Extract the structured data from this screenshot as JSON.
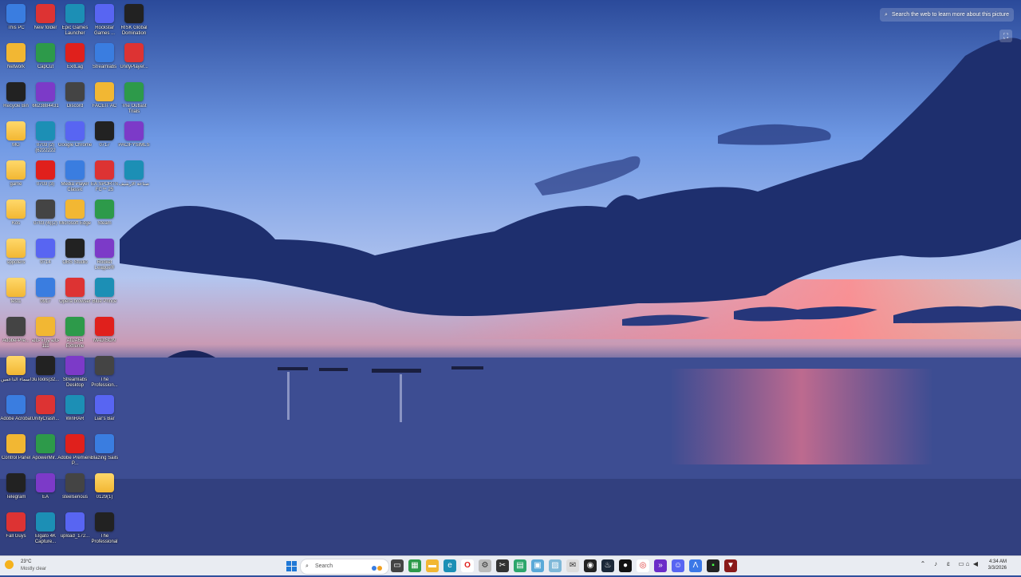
{
  "desktop": {
    "lens": {
      "label": "Search the web to learn more about this picture",
      "icon": "visual-search-icon",
      "corner_icon": "lens-corner-icon"
    },
    "icons": [
      [
        "This PC",
        "Network",
        "Recycle Bin",
        "MG",
        "game",
        "Kos",
        "sppoters",
        "test1",
        "Adobe-Pre...",
        "اسماء الداعمين",
        "Adobe Acrobat",
        "Control Panel",
        "Telegram",
        "Fall Guys"
      ],
      [
        "New folder",
        "CapCut",
        "6623884431",
        "0703 (2)(6222222",
        "0703 (3)",
        "0703 (4)(2)",
        "0714",
        "0917",
        "حالة وراء حالة 111",
        "3uTools(32...",
        "UnityCrash...",
        "ApowerMir...",
        "EA",
        "Elgato 4K Capture..."
      ],
      [
        "Epic Games Launcher",
        "ExitLag",
        "Discord",
        "Google Chrome",
        "Media Player Classic",
        "Microsoft Edge",
        "OBS Studio",
        "Opera browser",
        "AIDA64 Extreme",
        "Streamlabs Desktop",
        "WinRAR",
        "Adobe Premiere P...",
        "steelserious",
        "upload_172..."
      ],
      [
        "Rockstar Games ...",
        "Streamlabs",
        "FACEIT AC",
        "0717",
        "EA SPORTS FC™ 25",
        "Steam",
        "Rocket League®",
        "Blue Prince",
        "MADISON",
        "The Profession...",
        "Liar's Bar",
        "Blazing Sails",
        "0129(1)",
        "The Professional"
      ],
      [
        "RISK Global Domination",
        "UnityPlayer...",
        "The Outlast Trials",
        "PACIFYSIMLS",
        "صناعة الأرشيف",
        "",
        "",
        "",
        "",
        "",
        "",
        "",
        "",
        ""
      ]
    ]
  },
  "taskbar": {
    "weather": {
      "temp": "23°C",
      "condition": "Mostly clear"
    },
    "search_placeholder": "Search",
    "clock": {
      "time": "4:34 AM",
      "date": "3/3/2026"
    },
    "tray_extra": "ɛ"
  },
  "colors": {
    "taskbar_bg": "#e9ecf2",
    "accent": "#1f78d6"
  }
}
